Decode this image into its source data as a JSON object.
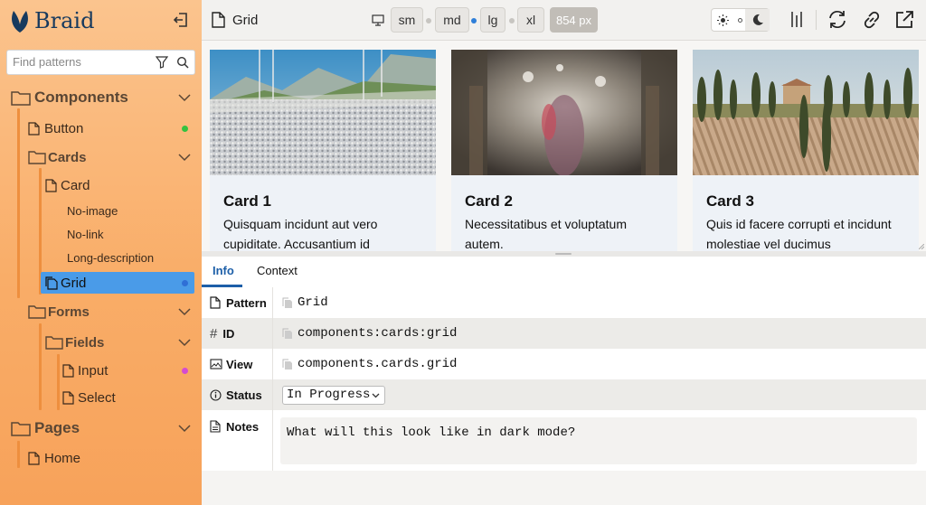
{
  "app": {
    "name": "Braid"
  },
  "sidebar": {
    "search_placeholder": "Find patterns",
    "tree": {
      "components": "Components",
      "button": "Button",
      "cards": "Cards",
      "card": "Card",
      "no_image": "No-image",
      "no_link": "No-link",
      "long_description": "Long-description",
      "grid": "Grid",
      "forms": "Forms",
      "fields": "Fields",
      "input": "Input",
      "select": "Select",
      "pages": "Pages",
      "home": "Home"
    },
    "status_colors": {
      "button": "#34c240",
      "grid": "#2f6fd6",
      "input": "#d54bd0"
    }
  },
  "toolbar": {
    "title": "Grid",
    "breakpoints": [
      "sm",
      "md",
      "lg",
      "xl"
    ],
    "width": "854 px",
    "active_breakpoint": "md"
  },
  "preview": {
    "cards": [
      {
        "title": "Card 1",
        "text": "Quisquam incidunt aut vero cupiditate. Accusantium id"
      },
      {
        "title": "Card 2",
        "text": "Necessitatibus et voluptatum autem."
      },
      {
        "title": "Card 3",
        "text": "Quis id facere corrupti et incidunt molestiae vel ducimus"
      }
    ]
  },
  "info": {
    "tabs": [
      "Info",
      "Context"
    ],
    "active_tab": "Info",
    "rows": {
      "pattern": {
        "label": "Pattern",
        "value": "Grid"
      },
      "id": {
        "label": "ID",
        "value": "components:cards:grid"
      },
      "view": {
        "label": "View",
        "value": "components.cards.grid"
      },
      "status": {
        "label": "Status",
        "value": "In Progress"
      },
      "notes": {
        "label": "Notes",
        "value": "What will this look like in dark mode?"
      }
    }
  },
  "colors": {
    "accent": "#2f7fd9",
    "active_tab": "#1d5fa8"
  }
}
